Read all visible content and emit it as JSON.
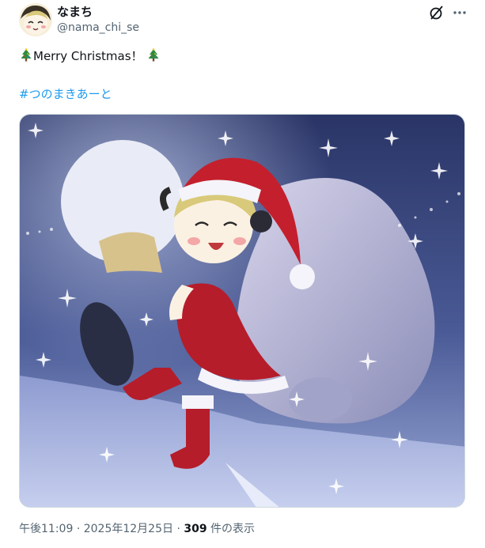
{
  "author": {
    "display_name": "なまち",
    "handle": "@nama_chi_se",
    "avatar_icon": "avatar-image"
  },
  "tweet": {
    "text": "Merry Christmas！",
    "emoji_icon": "christmas-tree-icon",
    "hashtag": "#つのまきあーと"
  },
  "media": {
    "icon": "illustration-image"
  },
  "meta": {
    "time": "午後11:09",
    "separator": "·",
    "date": "2025年12月25日",
    "views_count": "309",
    "views_label": "件の表示"
  },
  "colors": {
    "link": "#1d9bf0",
    "secondary_text": "#536471",
    "primary_text": "#0f1419"
  }
}
